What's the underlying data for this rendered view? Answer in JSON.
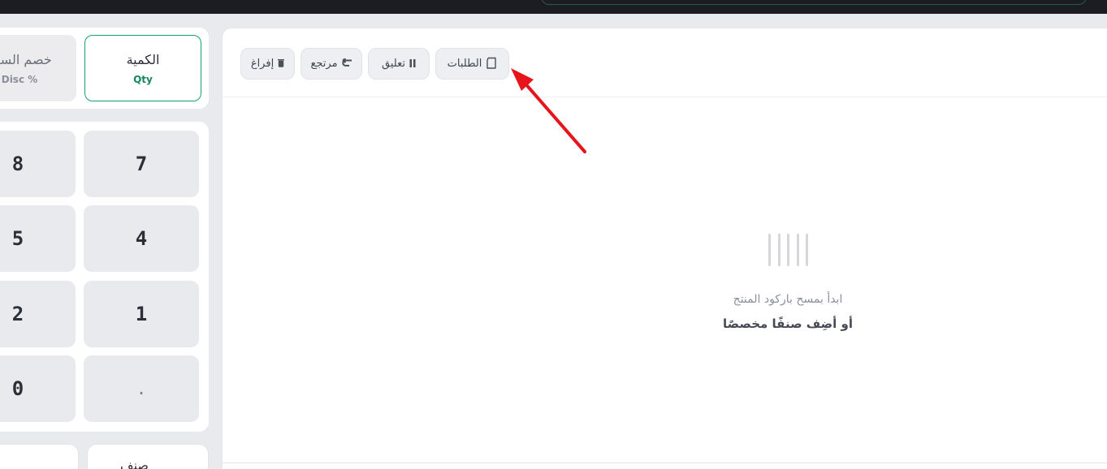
{
  "mode_selector": {
    "qty": {
      "label_ar": "الكمية",
      "label_en": "Qty",
      "active": true
    },
    "discount": {
      "label_ar": "خصم السعر",
      "label_en": "Disc %"
    }
  },
  "keypad": {
    "keys": [
      "7",
      "8",
      "4",
      "5",
      "1",
      "2",
      ".",
      "0"
    ]
  },
  "bottom_row": {
    "right_label": "صنف"
  },
  "toolbar": {
    "orders": {
      "label": "الطلبات",
      "icon": "receipt-icon"
    },
    "suspend": {
      "label": "تعليق",
      "icon": "pause-icon"
    },
    "return": {
      "label": "مرتجع",
      "icon": "return-arrow-icon"
    },
    "clear": {
      "label": "إفراغ",
      "icon": "trash-icon"
    }
  },
  "empty_state": {
    "icon": "barcode-icon",
    "line1": "ابدأ بمسح باركود المنتج",
    "line2": "أو أضِف صنفًا مخصصًا"
  },
  "colors": {
    "accent": "#16a06b",
    "annotation_arrow": "#e8141b",
    "topbar": "#1b1d22"
  }
}
